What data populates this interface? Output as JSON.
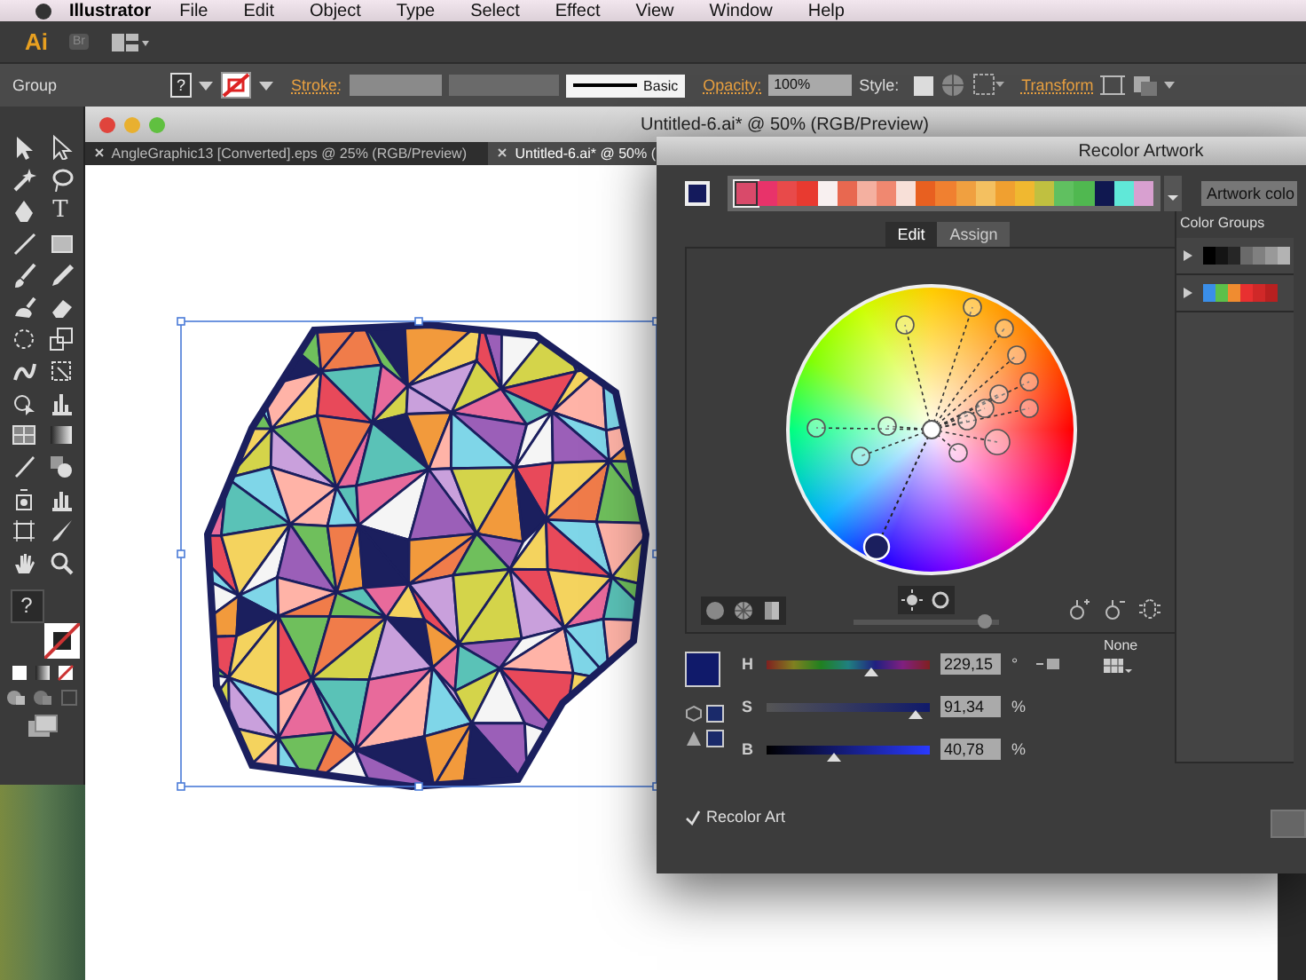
{
  "menu_bar": {
    "app": "Illustrator",
    "items": [
      "File",
      "Edit",
      "Object",
      "Type",
      "Select",
      "Effect",
      "View",
      "Window",
      "Help"
    ]
  },
  "app_bar": {
    "logo": "Ai",
    "bridge": "Br"
  },
  "control_bar": {
    "selection": "Group",
    "fill_glyph": "?",
    "stroke_label": "Stroke:",
    "brush_definition": "Basic",
    "opacity_label": "Opacity:",
    "opacity": "100%",
    "style_label": "Style:",
    "transform_link": "Transform"
  },
  "document": {
    "title": "Untitled-6.ai* @ 50% (RGB/Preview)",
    "tabs": [
      {
        "label": "AngleGraphic13 [Converted].eps @ 25% (RGB/Preview)",
        "selected": false
      },
      {
        "label": "Untitled-6.ai* @ 50% (",
        "selected": true
      }
    ]
  },
  "toolbar": {
    "type_glyph": "T",
    "fill_glyph": "?"
  },
  "recolor_dialog": {
    "title": "Recolor Artwork",
    "swatches": [
      {
        "color": "#d94a6a",
        "selected": true
      },
      {
        "color": "#e8336a",
        "selected": false
      },
      {
        "color": "#e84a4a",
        "selected": false
      },
      {
        "color": "#e83a30",
        "selected": false
      },
      {
        "color": "#f8f0f0",
        "selected": false
      },
      {
        "color": "#e86850",
        "selected": false
      },
      {
        "color": "#f4b0a0",
        "selected": false
      },
      {
        "color": "#f08870",
        "selected": false
      },
      {
        "color": "#f8e0d8",
        "selected": false
      },
      {
        "color": "#e86020",
        "selected": false
      },
      {
        "color": "#f08030",
        "selected": false
      },
      {
        "color": "#f0a040",
        "selected": false
      },
      {
        "color": "#f4c060",
        "selected": false
      },
      {
        "color": "#f0a030",
        "selected": false
      },
      {
        "color": "#f0b830",
        "selected": false
      },
      {
        "color": "#c0c040",
        "selected": false
      },
      {
        "color": "#60c060",
        "selected": false
      },
      {
        "color": "#50b850",
        "selected": false
      },
      {
        "color": "#101850",
        "selected": false
      },
      {
        "color": "#60e8d8",
        "selected": false
      },
      {
        "color": "#d8a0d0",
        "selected": false
      }
    ],
    "artwork_colors_button": "Artwork colo",
    "tabs": [
      {
        "label": "Edit",
        "selected": true
      },
      {
        "label": "Assign",
        "selected": false
      }
    ],
    "wheel_brightness": {
      "level": 0.9
    },
    "sliders": [
      {
        "label": "H",
        "level": 0.64,
        "value": "229,15",
        "unit": "°"
      },
      {
        "label": "S",
        "level": 0.91,
        "value": "91,34",
        "unit": "%"
      },
      {
        "label": "B",
        "level": 0.41,
        "value": "40,78",
        "unit": "%"
      }
    ],
    "none_label": "None",
    "recolor_art": {
      "label": "Recolor Art",
      "checked": true
    },
    "color_groups": {
      "title": "Color Groups",
      "groups": [
        {
          "expanded": false,
          "swatches": [
            {
              "color": "#000000"
            },
            {
              "color": "#141414"
            },
            {
              "color": "#262626"
            },
            {
              "color": "#6a6a6a"
            },
            {
              "color": "#808080"
            },
            {
              "color": "#999999"
            },
            {
              "color": "#b3b3b3"
            }
          ]
        },
        {
          "expanded": false,
          "swatches": [
            {
              "color": "#3a8ee8"
            },
            {
              "color": "#5cc04a"
            },
            {
              "color": "#f08c30"
            },
            {
              "color": "#e83030"
            },
            {
              "color": "#d02828"
            },
            {
              "color": "#b82020"
            }
          ]
        }
      ]
    }
  }
}
